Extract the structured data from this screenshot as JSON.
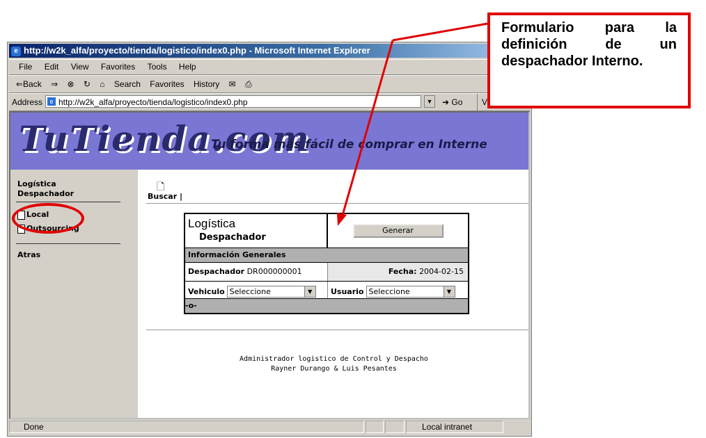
{
  "window": {
    "title": "http://w2k_alfa/proyecto/tienda/logistico/index0.php - Microsoft Internet Explorer"
  },
  "menu": [
    "File",
    "Edit",
    "View",
    "Favorites",
    "Tools",
    "Help"
  ],
  "toolbar": {
    "back": "⇐Back",
    "search": "Search",
    "favorites": "Favorites",
    "history": "History"
  },
  "address": {
    "label": "Address",
    "url": "http://w2k_alfa/proyecto/tienda/logistico/index0.php",
    "go": "Go",
    "links": "Vínculos"
  },
  "banner": {
    "logo": "TuTienda.com",
    "slogan": "Tu forma más fácil de comprar en Interne"
  },
  "sidebar": {
    "title1": "Logística",
    "title2": "Despachador",
    "links": [
      "Local",
      "Outsourcing"
    ],
    "back": "Atras"
  },
  "main": {
    "buscar": "Buscar",
    "buscar_sep": "|"
  },
  "form": {
    "title1": "Logística",
    "title2": "Despachador",
    "generate_button": "Generar",
    "section_header": "Información Generales",
    "dispatcher_label": "Despachador",
    "dispatcher_value": "DR000000001",
    "date_label": "Fecha:",
    "date_value": "2004-02-15",
    "vehicle_label": "Vehiculo",
    "vehicle_select": "Seleccione",
    "user_label": "Usuario",
    "user_select": "Seleccione",
    "footer": "-o-"
  },
  "credits": {
    "line1": "Administrador logistico de Control y Despacho",
    "line2": "Rayner Durango & Luis Pesantes"
  },
  "status": {
    "text": "Done",
    "zone": "Local intranet"
  },
  "callout": {
    "text": "Formulario para la definición de un despachador Interno."
  },
  "colors": {
    "banner": "#7a76d4",
    "annotation": "#e00000",
    "titlebar": "#0a246a"
  }
}
